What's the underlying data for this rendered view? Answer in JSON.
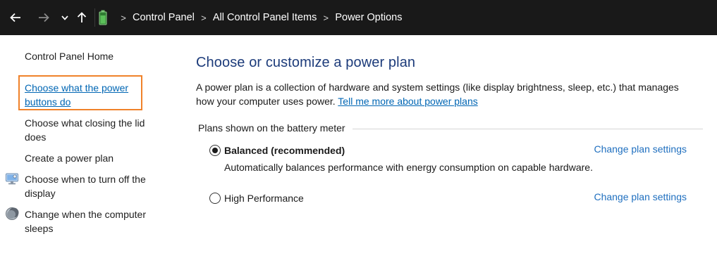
{
  "nav": {
    "back_icon": "arrow-left-icon",
    "forward_icon": "arrow-right-icon",
    "recent_icon": "chevron-down-icon",
    "up_icon": "arrow-up-icon",
    "location_icon": "battery-icon"
  },
  "breadcrumb": {
    "separator": ">",
    "items": [
      "Control Panel",
      "All Control Panel Items",
      "Power Options"
    ]
  },
  "left_pane": {
    "home": "Control Panel Home",
    "power_buttons": [
      "Choose what the power",
      "buttons do"
    ],
    "closing_lid": [
      "Choose what closing the lid",
      "does"
    ],
    "create_plan": "Create a power plan",
    "turn_off_display": [
      "Choose when to turn off the",
      "display"
    ],
    "computer_sleeps": [
      "Change when the computer",
      "sleeps"
    ]
  },
  "main": {
    "title": "Choose or customize a power plan",
    "description": "A power plan is a collection of hardware and system settings (like display brightness, sleep, etc.) that manages how your computer uses power.",
    "learn_more": "Tell me more about power plans",
    "group_label": "Plans shown on the battery meter",
    "plans": [
      {
        "name": "Balanced (recommended)",
        "selected": true,
        "description": "Automatically balances performance with energy consumption on capable hardware.",
        "link": "Change plan settings"
      },
      {
        "name": "High Performance",
        "selected": false,
        "description": "",
        "link": "Change plan settings"
      }
    ]
  },
  "colors": {
    "nav_background": "#191919",
    "title": "#1c3b7a",
    "link": "#0066b4",
    "focus_outline": "#f0822a"
  }
}
